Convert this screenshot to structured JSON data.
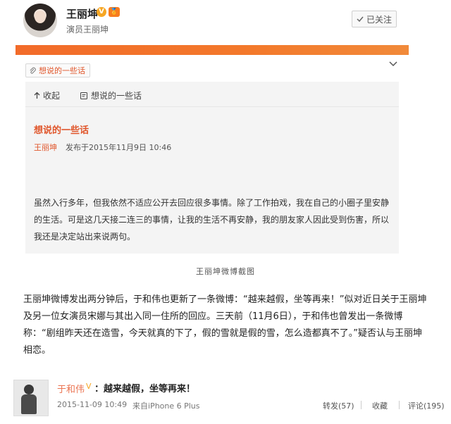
{
  "profile": {
    "name": "王丽坤",
    "verified_mark": "V",
    "level_mark": "🏅",
    "subtitle": "演员王丽坤",
    "follow_button": "已关注"
  },
  "article": {
    "topic_tag": "想说的一些话",
    "card_bar": {
      "collapse_label": "收起",
      "link_label": "想说的一些话"
    },
    "title": "想说的一些话",
    "author": "王丽坤",
    "published": "发布于2015年11月9日 10:46",
    "body": "虽然入行多年，但我依然不适应公开去回应很多事情。除了工作拍戏，我在自己的小圈子里安静的生活。可是这几天接二连三的事情，让我的生活不再安静，我的朋友家人因此受到伤害，所以我还是决定站出来说两句。"
  },
  "caption": "王丽坤微博截图",
  "paragraph": "王丽坤微博发出两分钟后，于和伟也更新了一条微博：“越来越假，坐等再来！”似对近日关于王丽坤及另一位女演员宋娜与其出入同一住所的回应。三天前（11月6日），于和伟也曾发出一条微博称：“剧组昨天还在造雪，今天就真的下了，假的雪就是假的雪，怎么造都真不了。”疑否认与王丽坤相恋。",
  "post": {
    "name": "于和伟",
    "verified_mark": "V",
    "text": "：越来越假，坐等再来！",
    "time": "2015-11-09 10:49",
    "source": "来自iPhone 6 Plus",
    "repost": "转发(57)",
    "favorite": "收藏",
    "comment": "评论(195)"
  },
  "colors": {
    "accent": "#e0562b",
    "banner": "#f26b2a",
    "card_bg": "#f4f4f4"
  }
}
